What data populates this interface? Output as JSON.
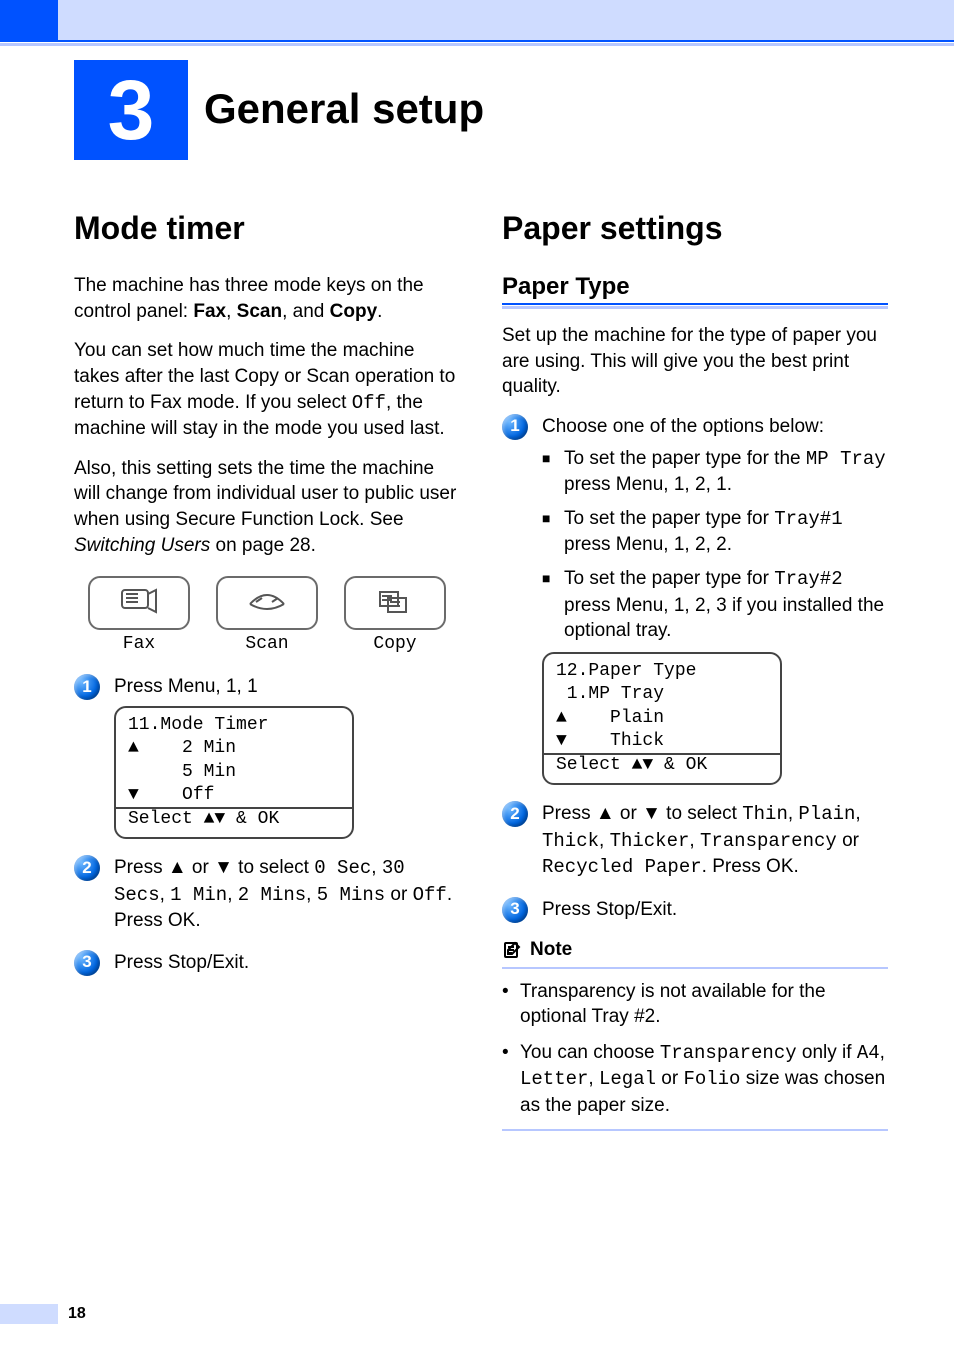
{
  "chapter": {
    "number": "3",
    "title": "General setup"
  },
  "left": {
    "h1": "Mode timer",
    "intro1_a": "The machine has three mode keys on the control panel: ",
    "intro1_bold": "Fax",
    "intro1_b": ", ",
    "intro1_bold2": "Scan",
    "intro1_c": ", and ",
    "intro1_bold3": "Copy",
    "intro1_d": ".",
    "intro2_a": "You can set how much time the machine takes after the last Copy or Scan operation to return to Fax mode. If you select ",
    "intro2_mono": "Off",
    "intro2_b": ", the machine will stay in the mode you used last.",
    "intro3_a": "Also, this setting sets the time the machine will change from individual user to public user when using Secure Function Lock. See ",
    "intro3_italic": "Switching Users",
    "intro3_b": " on page 28.",
    "keys": {
      "fax": "Fax",
      "scan": "Scan",
      "copy": "Copy"
    },
    "steps": [
      {
        "num": "1",
        "pre": "Press ",
        "bold1": "Menu",
        "mid": ", ",
        "bold2": "1",
        "mid2": ", ",
        "bold3": "1"
      },
      {
        "num": "2",
        "pre": "Press ▲ or ▼ to select ",
        "opts": [
          "0 Sec",
          "30 Secs",
          "1 Min",
          "2 Mins",
          "5 Mins",
          "Off"
        ],
        "sep_or": " or ",
        "post_a": ". Press ",
        "post_bold": "OK",
        "post_b": "."
      },
      {
        "num": "3",
        "pre": "Press ",
        "bold1": "Stop/Exit",
        "post": "."
      }
    ],
    "lcd": {
      "l1": "11.Mode Timer",
      "l2": "    2 Min",
      "l3": "    5 Min",
      "l4": "    Off",
      "l5_a": "Select ",
      "l5_b": " & OK"
    }
  },
  "right": {
    "h1": "Paper settings",
    "h2": "Paper Type",
    "intro": "Set up the machine for the type of paper you are using. This will give you the best print quality.",
    "step1": {
      "num": "1",
      "lead": "Choose one of the options below:",
      "bul1_a": "To set the paper type for the ",
      "bul1_mono": "MP Tray",
      "bul1_b": " press ",
      "bul1_bold": "Menu",
      "bul1_c": ", ",
      "bul1_b1": "1",
      "bul1_b2": "2",
      "bul1_b3": "1",
      "bul1_d": ".",
      "bul2_a": "To set the paper type for ",
      "bul2_mono": "Tray#1",
      "bul2_b": " press ",
      "bul2_bold": "Menu",
      "bul2_b1": "1",
      "bul2_b2": "2",
      "bul2_b3": "2",
      "bul2_d": ".",
      "bul3_a": "To set the paper type for ",
      "bul3_mono": "Tray#2",
      "bul3_b": " press ",
      "bul3_bold": "Menu",
      "bul3_b1": "1",
      "bul3_b2": "2",
      "bul3_b3": "3",
      "bul3_c": " if you installed the optional tray."
    },
    "lcd": {
      "l1": "12.Paper Type",
      "l2": " 1.MP Tray",
      "l3": "    Plain",
      "l4": "    Thick",
      "l5_a": "Select ",
      "l5_b": " & OK"
    },
    "step2": {
      "num": "2",
      "pre": "Press ▲ or ▼ to select ",
      "opts": [
        "Thin",
        "Plain",
        "Thick",
        "Thicker",
        "Transparency",
        "Recycled Paper"
      ],
      "sep_or": " or ",
      "post_a": ". Press ",
      "post_bold": "OK",
      "post_b": "."
    },
    "step3": {
      "num": "3",
      "pre": "Press ",
      "bold": "Stop/Exit",
      "post": "."
    },
    "note": {
      "title": "Note",
      "n1": "Transparency is not available for the optional Tray #2.",
      "n2_a": "You can choose ",
      "n2_mono1": "Transparency",
      "n2_b": " only if ",
      "n2_mono2": "A4",
      "n2_c": ", ",
      "n2_mono3": "Letter",
      "n2_d": ", ",
      "n2_mono4": "Legal",
      "n2_e": " or ",
      "n2_mono5": "Folio",
      "n2_f": " size was chosen as the paper size."
    }
  },
  "page_number": "18"
}
